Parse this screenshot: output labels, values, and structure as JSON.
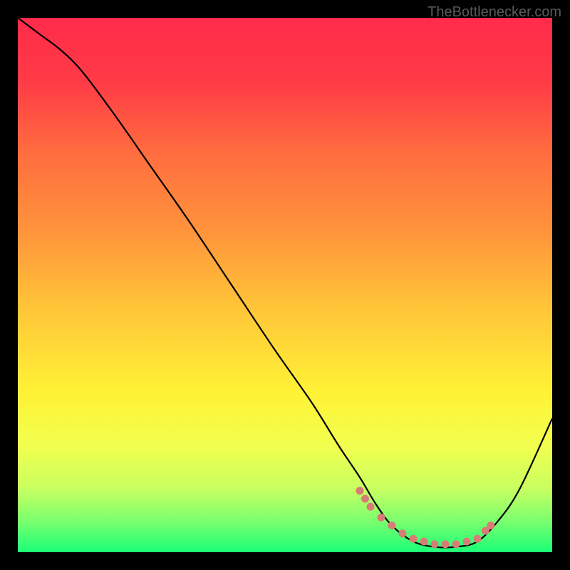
{
  "watermark": "TheBottlenecker.com",
  "chart_data": {
    "type": "line",
    "title": "",
    "xlabel": "",
    "ylabel": "",
    "xlim": [
      0,
      100
    ],
    "ylim": [
      0,
      100
    ],
    "background_gradient_stops": [
      {
        "offset": 0.0,
        "color": "#ff2b4a"
      },
      {
        "offset": 0.12,
        "color": "#ff3b46"
      },
      {
        "offset": 0.25,
        "color": "#ff6c3f"
      },
      {
        "offset": 0.4,
        "color": "#ff943b"
      },
      {
        "offset": 0.55,
        "color": "#ffc738"
      },
      {
        "offset": 0.7,
        "color": "#fff236"
      },
      {
        "offset": 0.8,
        "color": "#f2ff4e"
      },
      {
        "offset": 0.88,
        "color": "#c9ff60"
      },
      {
        "offset": 0.94,
        "color": "#7dff6e"
      },
      {
        "offset": 1.0,
        "color": "#1aff77"
      }
    ],
    "series": [
      {
        "name": "bottleneck-curve",
        "x": [
          0,
          4,
          8,
          12,
          18,
          25,
          32,
          40,
          48,
          55,
          60,
          64,
          67,
          70,
          74,
          78,
          82,
          86,
          90,
          94,
          100
        ],
        "y": [
          100,
          97,
          94,
          90,
          82,
          72,
          62,
          50,
          38,
          28,
          20,
          14,
          9,
          5,
          2,
          1,
          1,
          2,
          6,
          12,
          25
        ]
      }
    ],
    "scatter_overlay": {
      "name": "optimal-region-dots",
      "color": "#d97b77",
      "points": [
        {
          "x": 64,
          "y": 11.5
        },
        {
          "x": 65,
          "y": 10
        },
        {
          "x": 66,
          "y": 8.5
        },
        {
          "x": 68,
          "y": 6.5
        },
        {
          "x": 70,
          "y": 5
        },
        {
          "x": 72,
          "y": 3.5
        },
        {
          "x": 74,
          "y": 2.5
        },
        {
          "x": 76,
          "y": 2
        },
        {
          "x": 78,
          "y": 1.5
        },
        {
          "x": 80,
          "y": 1.5
        },
        {
          "x": 82,
          "y": 1.5
        },
        {
          "x": 84,
          "y": 2
        },
        {
          "x": 86,
          "y": 2.5
        },
        {
          "x": 87.5,
          "y": 4
        },
        {
          "x": 88.5,
          "y": 5
        }
      ]
    }
  }
}
